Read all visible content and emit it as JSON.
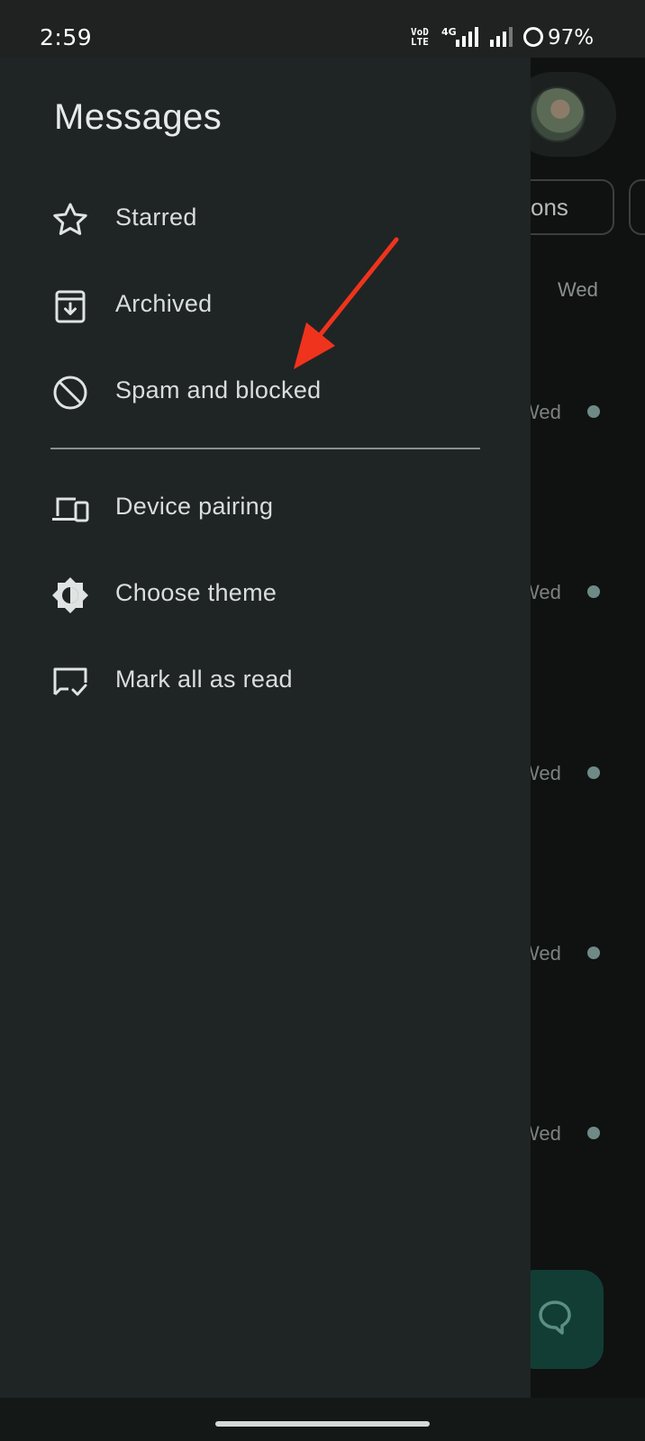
{
  "status_bar": {
    "time": "2:59",
    "network_label": "VoD LTE",
    "network_type": "4G",
    "battery": "97%"
  },
  "drawer": {
    "title": "Messages",
    "items": [
      {
        "label": "Starred",
        "icon": "star-icon"
      },
      {
        "label": "Archived",
        "icon": "archive-icon"
      },
      {
        "label": "Spam and blocked",
        "icon": "block-icon"
      },
      {
        "label": "Device pairing",
        "icon": "devices-icon"
      },
      {
        "label": "Choose theme",
        "icon": "theme-icon"
      },
      {
        "label": "Mark all as read",
        "icon": "mark-read-icon"
      }
    ]
  },
  "background": {
    "chip_label": "tions",
    "header_date": "Wed",
    "row_dates": [
      "Wed",
      "Wed",
      "Wed",
      "Wed",
      "Wed"
    ]
  },
  "colors": {
    "drawer_bg": "#1f2524",
    "annotation_arrow": "#f0331d",
    "unread_dot": "#6f8a86",
    "fab": "#123d35"
  }
}
